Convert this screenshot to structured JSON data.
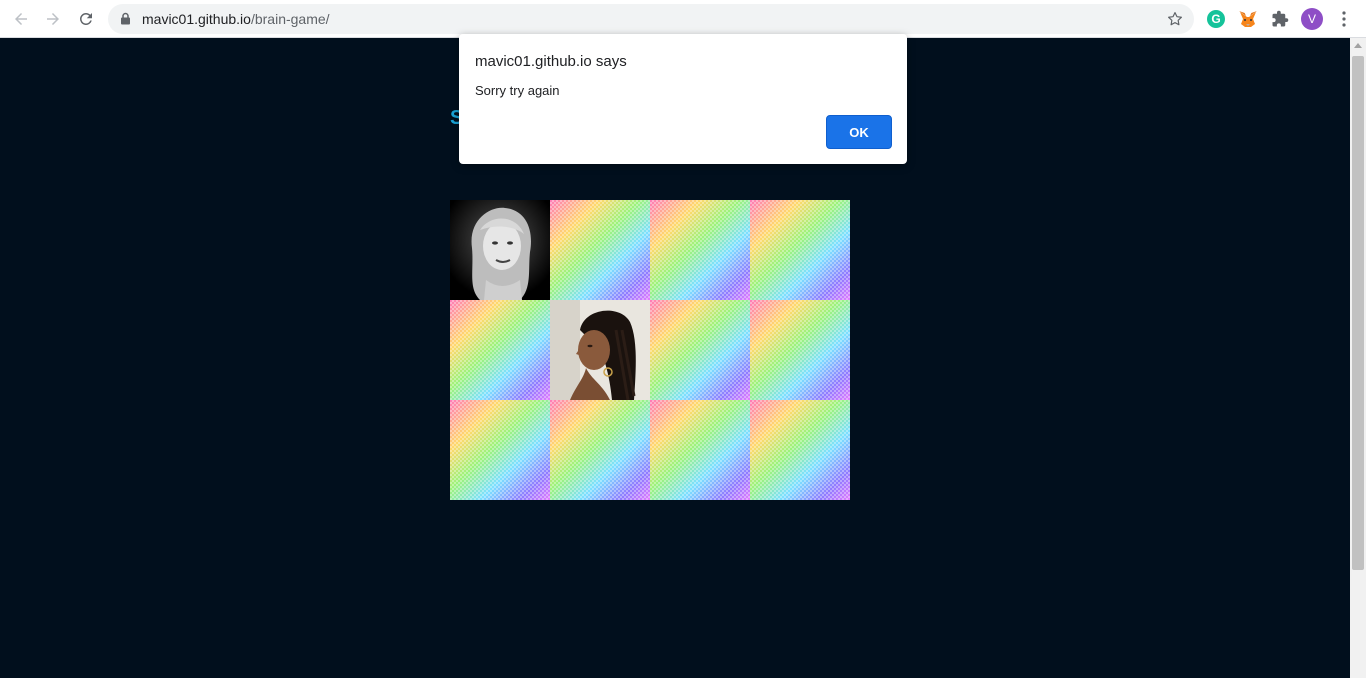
{
  "browser": {
    "url_host": "mavic01.github.io",
    "url_path": "/brain-game/",
    "profile_initial": "V",
    "grammarly_letter": "G",
    "accent_color": "#1a73e8"
  },
  "page": {
    "score_title": "S",
    "background": "#010f1d",
    "title_color": "#1aa3d6"
  },
  "board": {
    "rows": 3,
    "columns": 4,
    "cards": [
      {
        "state": "revealed",
        "content": "portrait-blonde-bw"
      },
      {
        "state": "hidden"
      },
      {
        "state": "hidden"
      },
      {
        "state": "hidden"
      },
      {
        "state": "hidden"
      },
      {
        "state": "revealed",
        "content": "portrait-braids"
      },
      {
        "state": "hidden"
      },
      {
        "state": "hidden"
      },
      {
        "state": "hidden"
      },
      {
        "state": "hidden"
      },
      {
        "state": "hidden"
      },
      {
        "state": "hidden"
      }
    ]
  },
  "dialog": {
    "title": "mavic01.github.io says",
    "message": "Sorry try again",
    "ok_label": "OK"
  },
  "icons": [
    "back-icon",
    "forward-icon",
    "reload-icon",
    "lock-icon",
    "star-icon",
    "grammarly-icon",
    "metamask-icon",
    "extensions-icon",
    "avatar",
    "menu-icon"
  ]
}
